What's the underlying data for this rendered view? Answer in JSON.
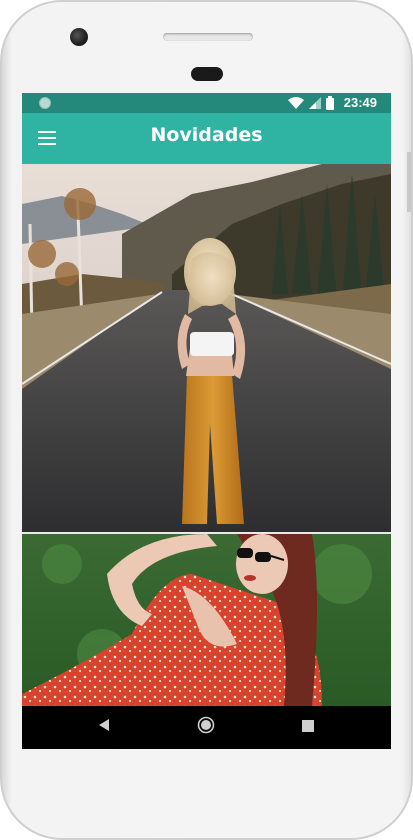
{
  "status_bar": {
    "time": "23:49",
    "icons": [
      "notification-dot-icon",
      "wifi-icon",
      "signal-icon",
      "battery-icon"
    ],
    "color": "#24897a"
  },
  "app_bar": {
    "title": "Novidades",
    "menu_icon": "hamburger-menu-icon",
    "color": "#2fb3a2"
  },
  "feed": {
    "items": [
      {
        "image": "woman-standing-on-mountain-road"
      },
      {
        "image": "woman-in-red-dress-lying-on-grass"
      }
    ]
  },
  "fab": {
    "icon": "shopping-cart-icon",
    "color": "#1f8a95"
  },
  "nav_bar": {
    "buttons": [
      "back-icon",
      "home-icon",
      "recents-icon"
    ]
  }
}
